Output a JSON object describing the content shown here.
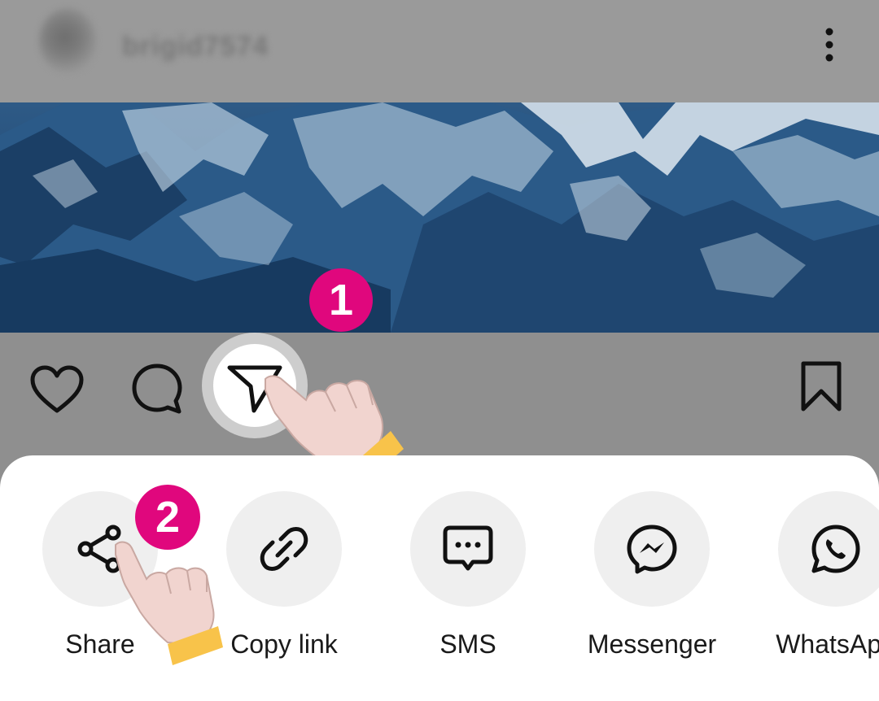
{
  "post": {
    "username": "brigid7574",
    "more_icon": "vertical-ellipsis-icon"
  },
  "actions": {
    "like_icon": "heart-icon",
    "comment_icon": "comment-bubble-icon",
    "share_icon": "paper-plane-icon",
    "save_icon": "bookmark-icon"
  },
  "steps": [
    {
      "number": "1",
      "color": "#e0077d"
    },
    {
      "number": "2",
      "color": "#e0077d"
    }
  ],
  "share_sheet": {
    "options": [
      {
        "label": "Share",
        "icon": "share-nodes-icon"
      },
      {
        "label": "Copy link",
        "icon": "link-icon"
      },
      {
        "label": "SMS",
        "icon": "message-icon"
      },
      {
        "label": "Messenger",
        "icon": "messenger-icon"
      },
      {
        "label": "WhatsApp",
        "icon": "whatsapp-icon"
      }
    ]
  },
  "colors": {
    "badge": "#e0077d",
    "cuff": "#f8c34a",
    "skin": "#f1d4cf"
  }
}
